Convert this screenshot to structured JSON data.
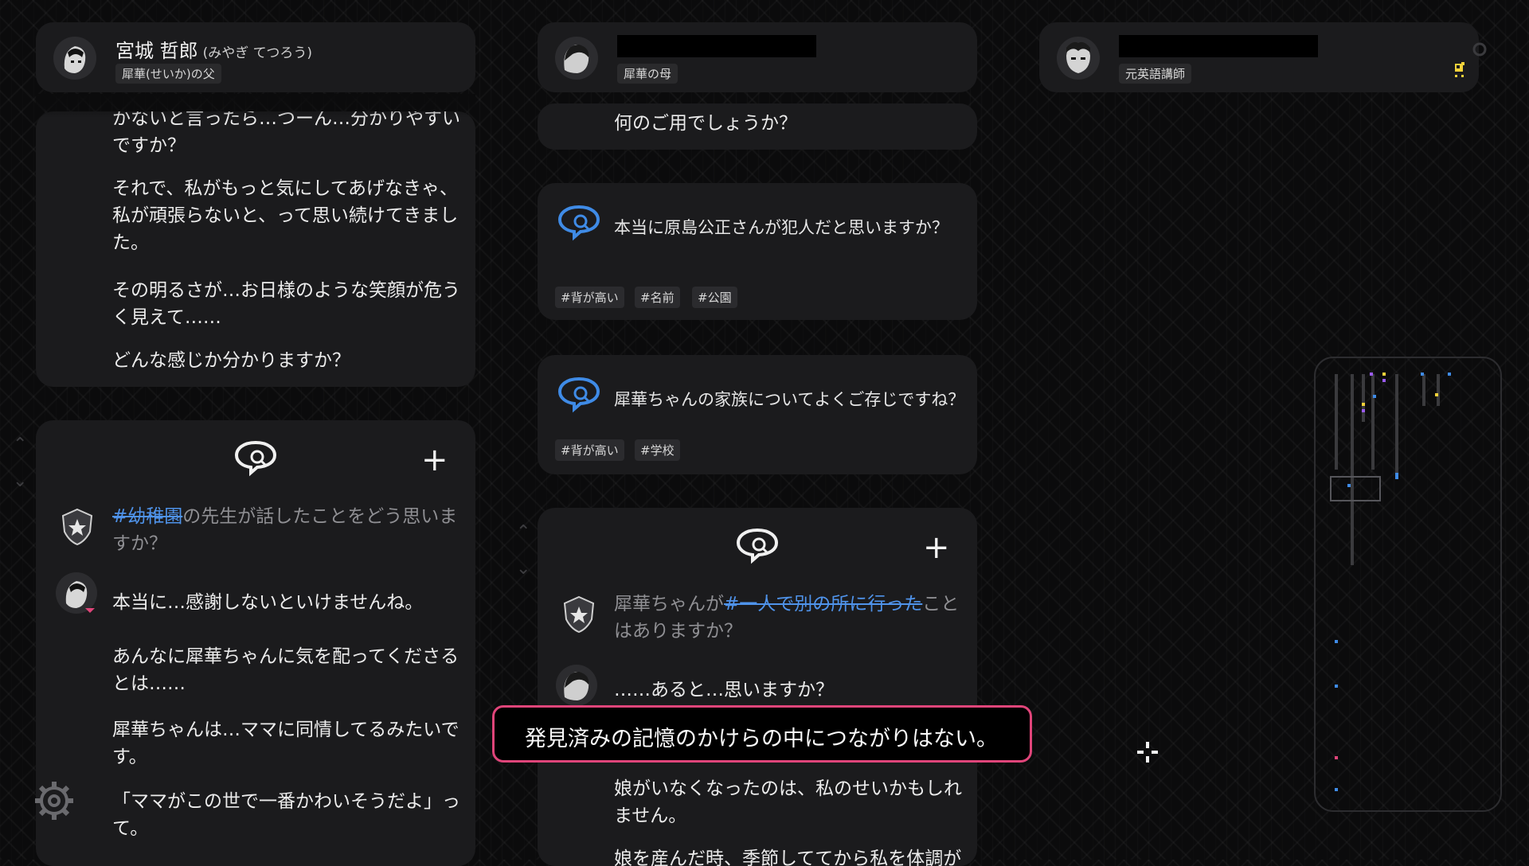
{
  "characters": [
    {
      "name": "宮城 哲郎",
      "reading": "(みやぎ てつろう)",
      "role": "犀華(せいか)の父"
    },
    {
      "name": "",
      "role": "犀華の母"
    },
    {
      "name": "",
      "role": "元英語講師"
    }
  ],
  "col1": {
    "log": [
      "かないと言ったら…つーん…分かりやすいですか？",
      "それで、私がもっと気にしてあげなきゃ、私が頑張らないと、って思い続けてきました。",
      "その明るさが…お日様のような笑顔が危うく見えて……",
      "どんな感じか分かりますか？"
    ],
    "question_prefix_link": "#幼稚園",
    "question_rest": "の先生が話したことをどう思いますか？",
    "answers": [
      "本当に…感謝しないといけませんね。",
      "あんなに犀華ちゃんに気を配ってくださるとは……",
      "犀華ちゃんは…ママに同情してるみたいです。",
      "「ママがこの世で一番かわいそうだよ」って。"
    ]
  },
  "col2": {
    "top_line": "何のご用でしょうか？",
    "questions": [
      {
        "text": "本当に原島公正さんが犯人だと思いますか？",
        "tags": [
          "#背が高い",
          "#名前",
          "#公園"
        ]
      },
      {
        "text": "犀華ちゃんの家族についてよくご存じですね？",
        "tags": [
          "#背が高い",
          "#学校"
        ]
      }
    ],
    "question_prefix": "犀華ちゃんが",
    "question_link": "#一人で別の所に行った",
    "question_rest": "ことはありますか？",
    "answers": [
      "……あると…思いますか？",
      "娘がいなくなったのは、私のせいかもしれません。",
      "娘を産んだ時、季節しててから私を体調が"
    ]
  },
  "toast": "発見済みの記憶のかけらの中につながりはない。",
  "icons": {
    "chat": "chat-bubble-icon",
    "plus": "plus-icon",
    "gear": "gear-icon",
    "badge": "police-badge-icon",
    "cursor": "crosshair-cursor-icon"
  },
  "colors": {
    "accent_pink": "#e0457a",
    "link_blue": "#4f93ea",
    "highlight_yellow": "#f3d23a"
  }
}
